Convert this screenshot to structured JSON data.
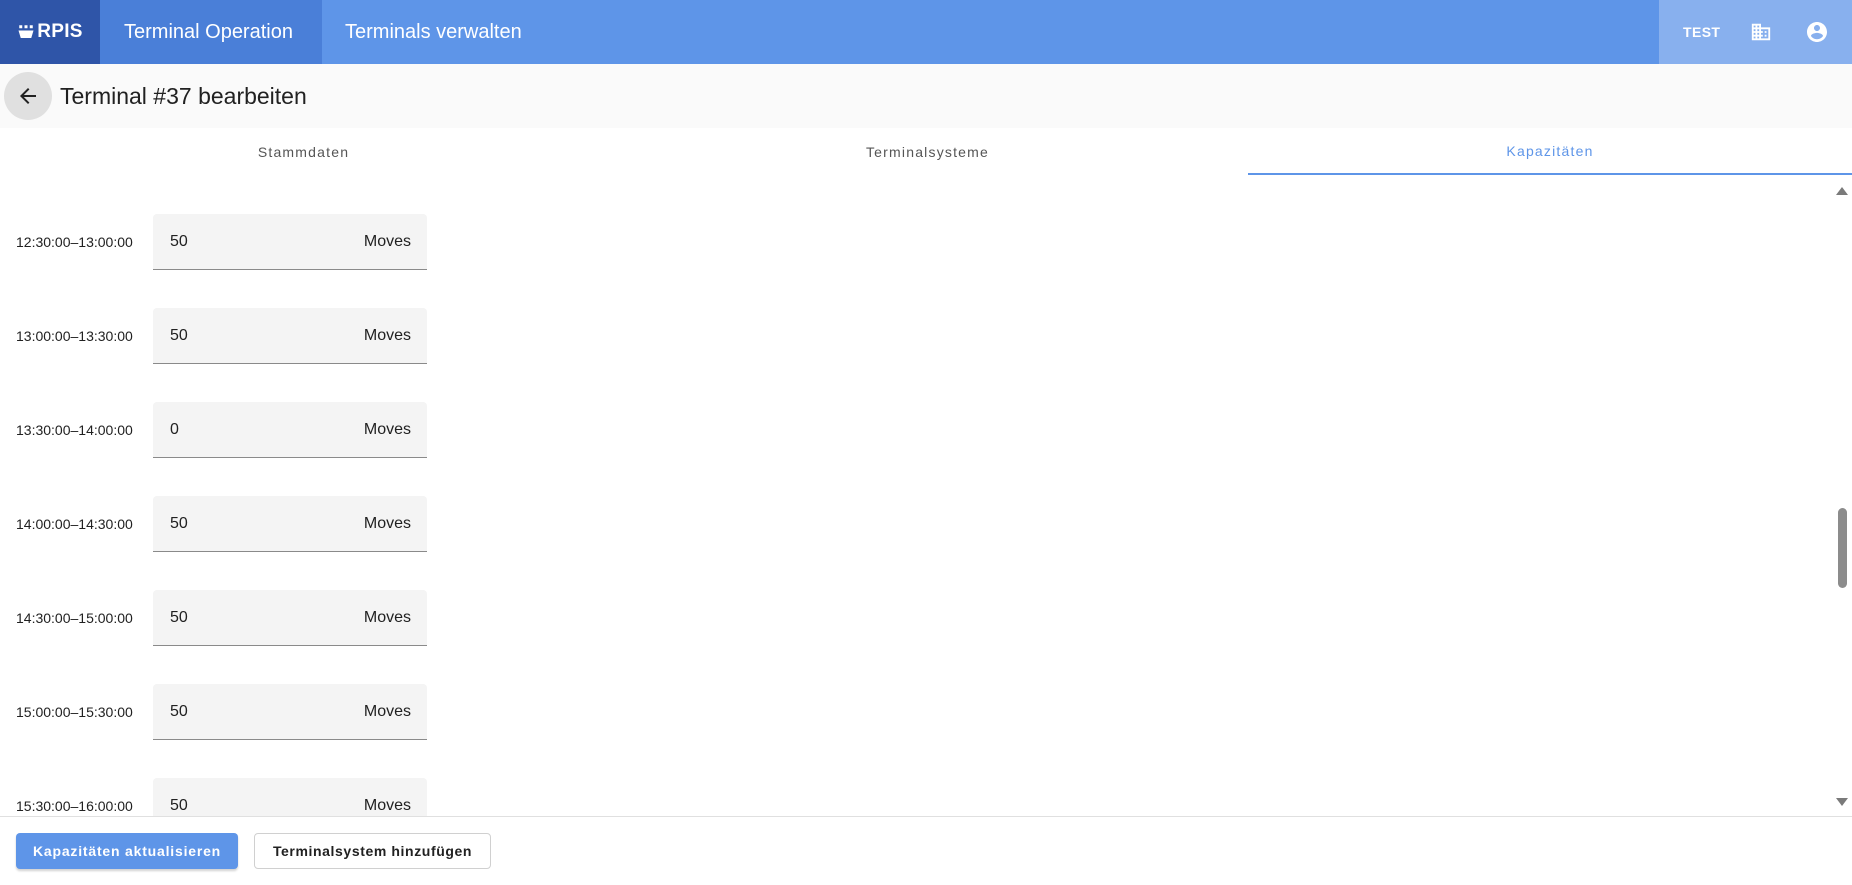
{
  "app": {
    "logo_text": "RPIS",
    "nav": [
      {
        "label": "Terminal Operation"
      },
      {
        "label": "Terminals verwalten"
      }
    ],
    "env_label": "TEST",
    "icons": [
      "building-icon",
      "account-circle-icon"
    ]
  },
  "header": {
    "title": "Terminal #37 bearbeiten",
    "back_icon": "arrow-left-icon"
  },
  "tabs": [
    {
      "label": "Stammdaten",
      "active": false
    },
    {
      "label": "Terminalsysteme",
      "active": false
    },
    {
      "label": "Kapazitäten",
      "active": true
    }
  ],
  "capacities": {
    "unit": "Moves",
    "slots": [
      {
        "time": "12:30:00–13:00:00",
        "value": "50"
      },
      {
        "time": "13:00:00–13:30:00",
        "value": "50"
      },
      {
        "time": "13:30:00–14:00:00",
        "value": "0"
      },
      {
        "time": "14:00:00–14:30:00",
        "value": "50"
      },
      {
        "time": "14:30:00–15:00:00",
        "value": "50"
      },
      {
        "time": "15:00:00–15:30:00",
        "value": "50"
      },
      {
        "time": "15:30:00–16:00:00",
        "value": "50"
      }
    ]
  },
  "footer": {
    "primary_label": "Kapazitäten aktualisieren",
    "secondary_label": "Terminalsystem hinzufügen"
  },
  "colors": {
    "primary": "#5e95e8",
    "logo_bg": "#2f55a8",
    "active_nav": "#4a7fd8"
  }
}
